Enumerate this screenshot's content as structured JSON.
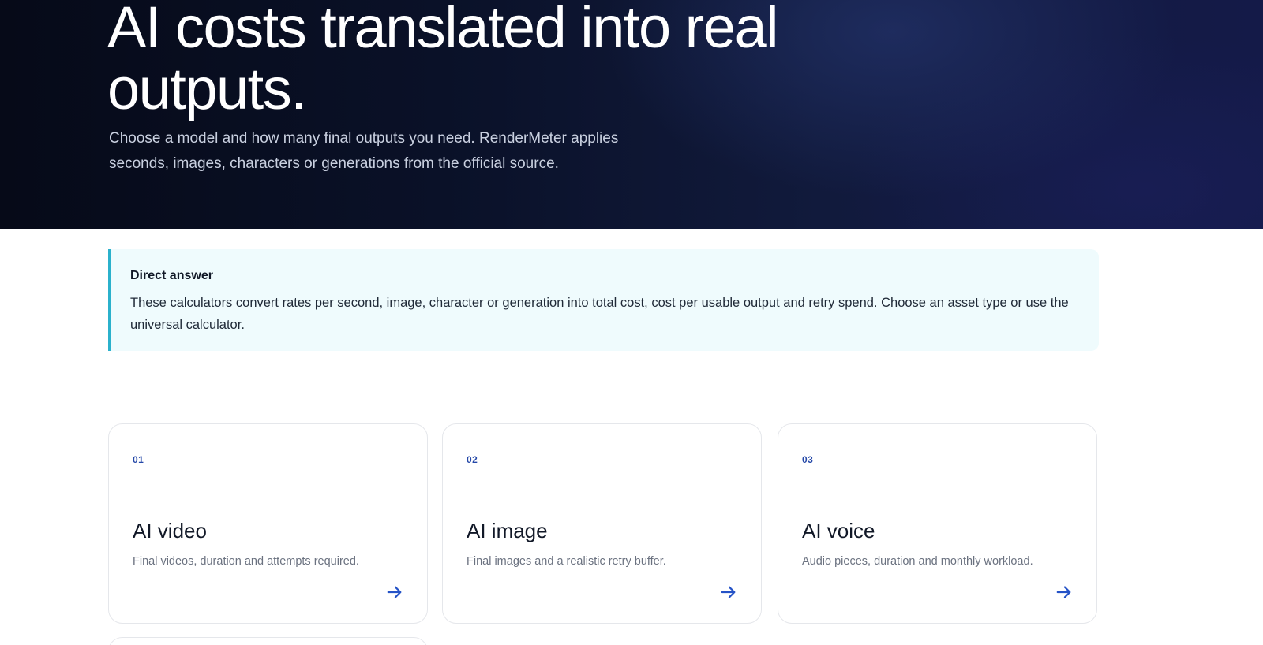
{
  "hero": {
    "title": "AI costs translated into real outputs.",
    "subtitle": "Choose a model and how many final outputs you need. RenderMeter applies seconds, images, characters or generations from the official source."
  },
  "direct_answer": {
    "heading": "Direct answer",
    "body": "These calculators convert rates per second, image, character or generation into total cost, cost per usable output and retry spend. Choose an asset type or use the universal calculator."
  },
  "cards": [
    {
      "number": "01",
      "title": "AI video",
      "description": "Final videos, duration and attempts required.",
      "icon": "arrow-right-icon"
    },
    {
      "number": "02",
      "title": "AI image",
      "description": "Final images and a realistic retry buffer.",
      "icon": "arrow-right-icon"
    },
    {
      "number": "03",
      "title": "AI voice",
      "description": "Audio pieces, duration and monthly workload.",
      "icon": "arrow-right-icon"
    }
  ],
  "colors": {
    "accent_arrow": "#2553c7",
    "answer_border": "#2bb1cc",
    "answer_background": "#effbfd",
    "hero_dark": "#0a1128"
  }
}
